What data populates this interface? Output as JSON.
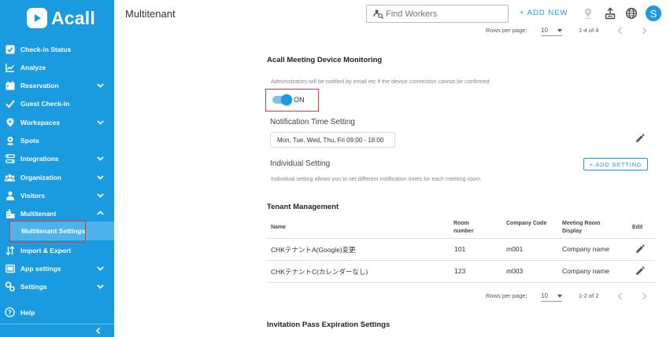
{
  "app": {
    "logo_text": "Acall",
    "page_title": "Multitenant"
  },
  "sidebar": {
    "items": [
      {
        "label": "Check-in Status",
        "icon": "check-square-icon"
      },
      {
        "label": "Analyze",
        "icon": "chart-line-icon"
      },
      {
        "label": "Reservation",
        "icon": "calendar-icon"
      },
      {
        "label": "Guest Check-in",
        "icon": "checkmark-icon"
      },
      {
        "label": "Workspaces",
        "icon": "location-pin-icon"
      },
      {
        "label": "Spots",
        "icon": "spot-pin-icon"
      },
      {
        "label": "Integrations",
        "icon": "integrations-icon"
      },
      {
        "label": "Organization",
        "icon": "group-icon"
      },
      {
        "label": "Visitors",
        "icon": "person-icon"
      },
      {
        "label": "Multitenant",
        "icon": "building-icon"
      },
      {
        "label": "Import & Export",
        "icon": "import-export-icon"
      },
      {
        "label": "App settings",
        "icon": "monitor-icon"
      },
      {
        "label": "Settings",
        "icon": "gear-icon"
      },
      {
        "label": "Help",
        "icon": "help-icon"
      }
    ],
    "sub_item": "Multitenant Settings"
  },
  "header": {
    "search_placeholder": "Find Workers",
    "add_new": "+ ADD NEW",
    "avatar_initial": "S"
  },
  "pager_top": {
    "rows_label": "Rows per page:",
    "rows_value": "10",
    "range": "1-4 of 4"
  },
  "monitoring": {
    "title": "Acall Meeting Device Monitoring",
    "note": "Administrators will be notified by email etc if the device connection cannot be confirmed",
    "toggle_label": "ON",
    "time_heading": "Notification Time Setting",
    "time_value": "Mon, Tue, Wed, Thu, Fri   09:00 - 18:00",
    "individual_heading": "Individual Setting",
    "add_setting": "+ ADD SETTING",
    "individual_note": "Individual setting allows you to set different notification times for each meeting room."
  },
  "tenant": {
    "title": "Tenant Management",
    "headers": {
      "name": "Name",
      "room": "Room\nnumber",
      "company": "Company Code",
      "display": "Meeting Room\nDisplay",
      "edit": "Edit"
    },
    "rows": [
      {
        "name": "CHKテナントA(Google)変更",
        "room": "101",
        "company": "m001",
        "display": "Company name"
      },
      {
        "name": "CHKテナントC(カレンダーなし)",
        "room": "123",
        "company": "m003",
        "display": "Company name"
      }
    ]
  },
  "pager_bottom": {
    "rows_label": "Rows per page:",
    "rows_value": "10",
    "range": "1-2 of 2"
  },
  "invitation": {
    "title": "Invitation Pass Expiration Settings"
  },
  "colors": {
    "brand": "#1a9be0",
    "highlight": "#e53935"
  }
}
